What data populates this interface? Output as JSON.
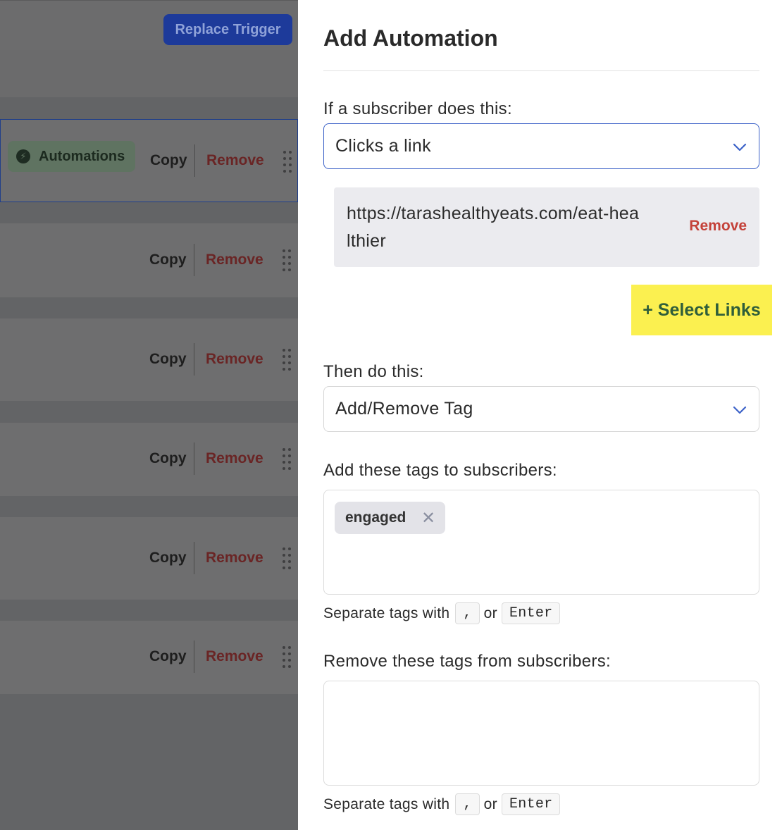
{
  "background": {
    "replace_trigger_label": "Replace Trigger",
    "automations_badge": "Automations",
    "rows": [
      {
        "copy": "Copy",
        "remove": "Remove"
      },
      {
        "copy": "Copy",
        "remove": "Remove"
      },
      {
        "copy": "Copy",
        "remove": "Remove"
      },
      {
        "copy": "Copy",
        "remove": "Remove"
      },
      {
        "copy": "Copy",
        "remove": "Remove"
      },
      {
        "copy": "Copy",
        "remove": "Remove"
      }
    ]
  },
  "drawer": {
    "title": "Add Automation",
    "trigger_label": "If a subscriber does this:",
    "trigger_value": "Clicks a link",
    "link": {
      "url": "https://tarashealthyeats.com/eat-healthier",
      "remove_label": "Remove"
    },
    "select_links_label": "+ Select Links",
    "action_label": "Then do this:",
    "action_value": "Add/Remove Tag",
    "add_tags_label": "Add these tags to subscribers:",
    "add_tags": [
      "engaged"
    ],
    "remove_tags_label": "Remove these tags from subscribers:",
    "hint": {
      "prefix": "Separate tags with",
      "key1": ",",
      "or": "or",
      "key2": "Enter"
    }
  },
  "colors": {
    "accent_blue": "#3c62c8",
    "danger_red": "#c4423a",
    "highlight_yellow": "#fbf050",
    "select_links_green": "#2f5e3a"
  }
}
